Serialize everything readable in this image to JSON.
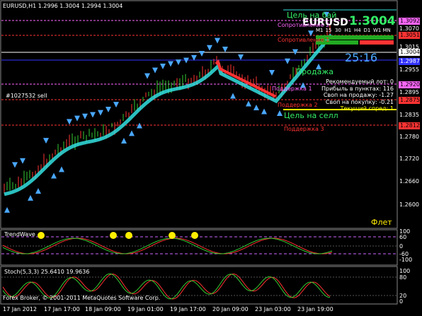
{
  "chart_header": "EURUSD,H1  1.2996 1.3004 1.2994 1.3004",
  "symbol_big": "EURUSD",
  "price_big": "1.3004",
  "timer": "25:16",
  "timeframes": [
    "M1",
    "15",
    "30",
    "H1",
    "H4",
    "D1",
    "W1",
    "MN"
  ],
  "labels": {
    "target_buy": "Цель на бай",
    "resistance_2": "Сопротивление 2",
    "resistance_1": "Сопротивление 1",
    "sell": "Продажа",
    "support_1": "Поддержка 1",
    "support_2": "Поддержка 2",
    "support_3": "Поддержка 3",
    "target_sell": "Цель на селл",
    "flat": "Флет",
    "order": "#1027532 sell"
  },
  "info_panel": [
    "Рекомендуемый лот: 0",
    "Прибыль в пунктах: 116",
    "Своп на продажу: -1.27",
    "Своп на покупку: -0.21",
    "Текущий спред: 1"
  ],
  "price_axis": [
    "1.3070",
    "1.3015",
    "1.2955",
    "1.2895",
    "1.2835",
    "1.2780",
    "1.2720",
    "1.2660",
    "1.2600"
  ],
  "price_tags": [
    {
      "text": "1.3092",
      "bg": "#ff66ff",
      "fg": "#000"
    },
    {
      "text": "1.3051",
      "bg": "#ff3333",
      "fg": "#000"
    },
    {
      "text": "1.3004",
      "bg": "#ffffff",
      "fg": "#000"
    },
    {
      "text": "1.2987",
      "bg": "#3333ff",
      "fg": "#fff"
    },
    {
      "text": "1.2920",
      "bg": "#ff66ff",
      "fg": "#000"
    },
    {
      "text": "1.2875",
      "bg": "#ff3333",
      "fg": "#000"
    },
    {
      "text": "1.2812",
      "bg": "#ff3333",
      "fg": "#000"
    }
  ],
  "trendwave": {
    "title": "TrendWave",
    "axis": [
      "100",
      "60",
      "0",
      "-60",
      "-100"
    ]
  },
  "stoch": {
    "title": "Stoch(5,3,3) 25.6410 19.9636",
    "axis": [
      "100",
      "80",
      "20",
      "0"
    ]
  },
  "dates": [
    "17 Jan 2012",
    "17 Jan 17:00",
    "18 Jan 09:00",
    "19 Jan 01:00",
    "19 Jan 17:00",
    "20 Jan 09:00",
    "23 Jan 03:00",
    "23 Jan 19:00"
  ],
  "copyright": "Forex Broker, © 2001-2011 MetaQuotes Software Corp.",
  "colors": {
    "bull": "#33cc33",
    "bear": "#ff3333",
    "cyan": "#33e0e0",
    "arrow": "#4aa8ff",
    "resistance": "#ff66ff",
    "support": "#ff3333",
    "target": "#33ee66"
  }
}
